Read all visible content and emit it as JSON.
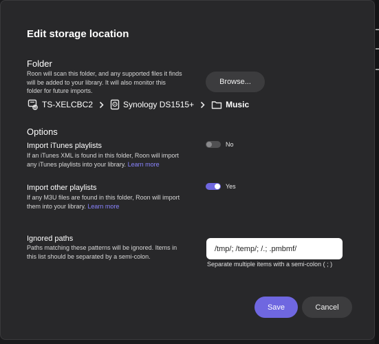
{
  "dialog": {
    "title": "Edit storage location"
  },
  "folder": {
    "heading": "Folder",
    "description_lines": [
      "Roon will scan this folder, and any supported files it finds",
      "will be added to your library. It will also monitor this",
      "folder for future imports."
    ],
    "browse_label": "Browse...",
    "path": {
      "device": "TS-XELCBC2",
      "share": "Synology DS1515+",
      "folder": "Music"
    }
  },
  "options": {
    "heading": "Options",
    "itunes": {
      "title": "Import iTunes playlists",
      "line1": "If an iTunes XML is found in this folder, Roon will import",
      "line2": "any iTunes playlists into your library.",
      "link": "Learn more",
      "state_label": "No",
      "enabled": false
    },
    "other": {
      "title": "Import other playlists",
      "line1": "If any M3U files are found in this folder, Roon will import",
      "line2": "them into your library.",
      "link": "Learn more",
      "state_label": "Yes",
      "enabled": true
    }
  },
  "ignored": {
    "heading": "Ignored paths",
    "description_lines": [
      "Paths matching these patterns will be ignored. Items in",
      "this list should be separated by a semi-colon."
    ],
    "value": "/tmp/; /temp/; /.; .pmbmf/",
    "hint": "Separate multiple items with a semi-colon ( ; )"
  },
  "actions": {
    "save_label": "Save",
    "cancel_label": "Cancel"
  },
  "colors": {
    "accent": "#6f67e0",
    "link": "#8a84ff",
    "dialog_bg": "#28282a"
  },
  "icons": {
    "device": "network-drive-icon",
    "share": "nas-drive-icon",
    "folder": "folder-icon",
    "separator": "chevron-right-icon"
  }
}
